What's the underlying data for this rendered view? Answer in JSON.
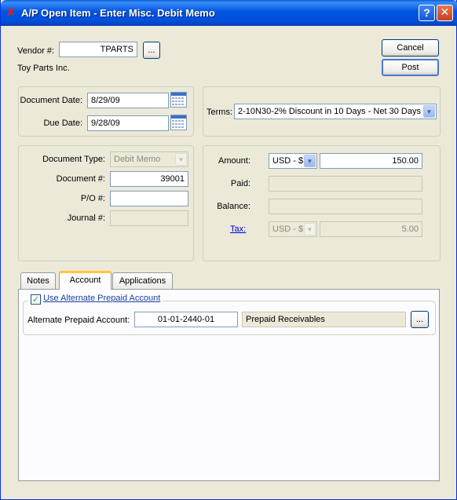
{
  "window": {
    "title": "A/P Open Item - Enter Misc. Debit Memo",
    "help_glyph": "?",
    "close_glyph": "✕"
  },
  "vendor": {
    "label": "Vendor #:",
    "value": "TPARTS",
    "lookup_label": "...",
    "name": "Toy Parts Inc."
  },
  "actions": {
    "cancel_label": "Cancel",
    "post_label": "Post"
  },
  "dates": {
    "document_date_label": "Document Date:",
    "document_date": "8/29/09",
    "due_date_label": "Due Date:",
    "due_date": "9/28/09"
  },
  "terms": {
    "label": "Terms:",
    "value": "2-10N30-2% Discount in 10 Days - Net 30 Days"
  },
  "document": {
    "type_label": "Document Type:",
    "type_value": "Debit Memo",
    "number_label": "Document #:",
    "number_value": "39001",
    "po_label": "P/O #:",
    "po_value": "",
    "journal_label": "Journal #:",
    "journal_value": ""
  },
  "amounts": {
    "amount_label": "Amount:",
    "currency": "USD - $",
    "amount_value": "150.00",
    "paid_label": "Paid:",
    "paid_value": "",
    "balance_label": "Balance:",
    "balance_value": "",
    "tax_label": "Tax:",
    "tax_currency": "USD - $",
    "tax_value": "5.00"
  },
  "tabs": [
    {
      "label": "Notes",
      "active": false
    },
    {
      "label": "Account",
      "active": true
    },
    {
      "label": "Applications",
      "active": false
    }
  ],
  "account_tab": {
    "checkbox_label": "Use Alternate Prepaid Account",
    "checked": true,
    "alt_account_label": "Alternate Prepaid Account:",
    "alt_account_number": "01-01-2440-01",
    "alt_account_name": "Prepaid Receivables",
    "lookup_label": "..."
  }
}
